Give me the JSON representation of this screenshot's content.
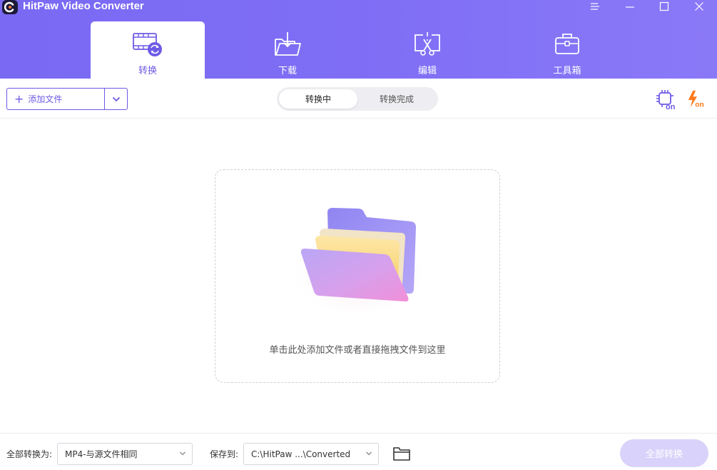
{
  "app": {
    "title": "HitPaw Video Converter"
  },
  "nav": {
    "tabs": [
      {
        "label": "转换",
        "icon": "film-convert-icon",
        "active": true
      },
      {
        "label": "下载",
        "icon": "download-folder-icon",
        "active": false
      },
      {
        "label": "编辑",
        "icon": "scissors-edit-icon",
        "active": false
      },
      {
        "label": "工具箱",
        "icon": "toolbox-icon",
        "active": false
      }
    ]
  },
  "toolbar": {
    "add_file_label": "添加文件",
    "segments": {
      "converting": "转换中",
      "completed": "转换完成"
    },
    "hw_accel_icon": "gpu-chip-on-icon",
    "fast_icon": "lightning-on-icon"
  },
  "dropzone": {
    "hint": "单击此处添加文件或者直接拖拽文件到这里"
  },
  "bottom": {
    "convert_all_to_label": "全部转换为:",
    "format_value": "MP4-与源文件相同",
    "save_to_label": "保存到:",
    "save_path": "C:\\HitPaw ...\\Converted",
    "convert_all_button": "全部转换"
  },
  "colors": {
    "accent": "#6d5ae6",
    "header": "#7f6ef5",
    "button_disabled": "#d9d3fb"
  }
}
